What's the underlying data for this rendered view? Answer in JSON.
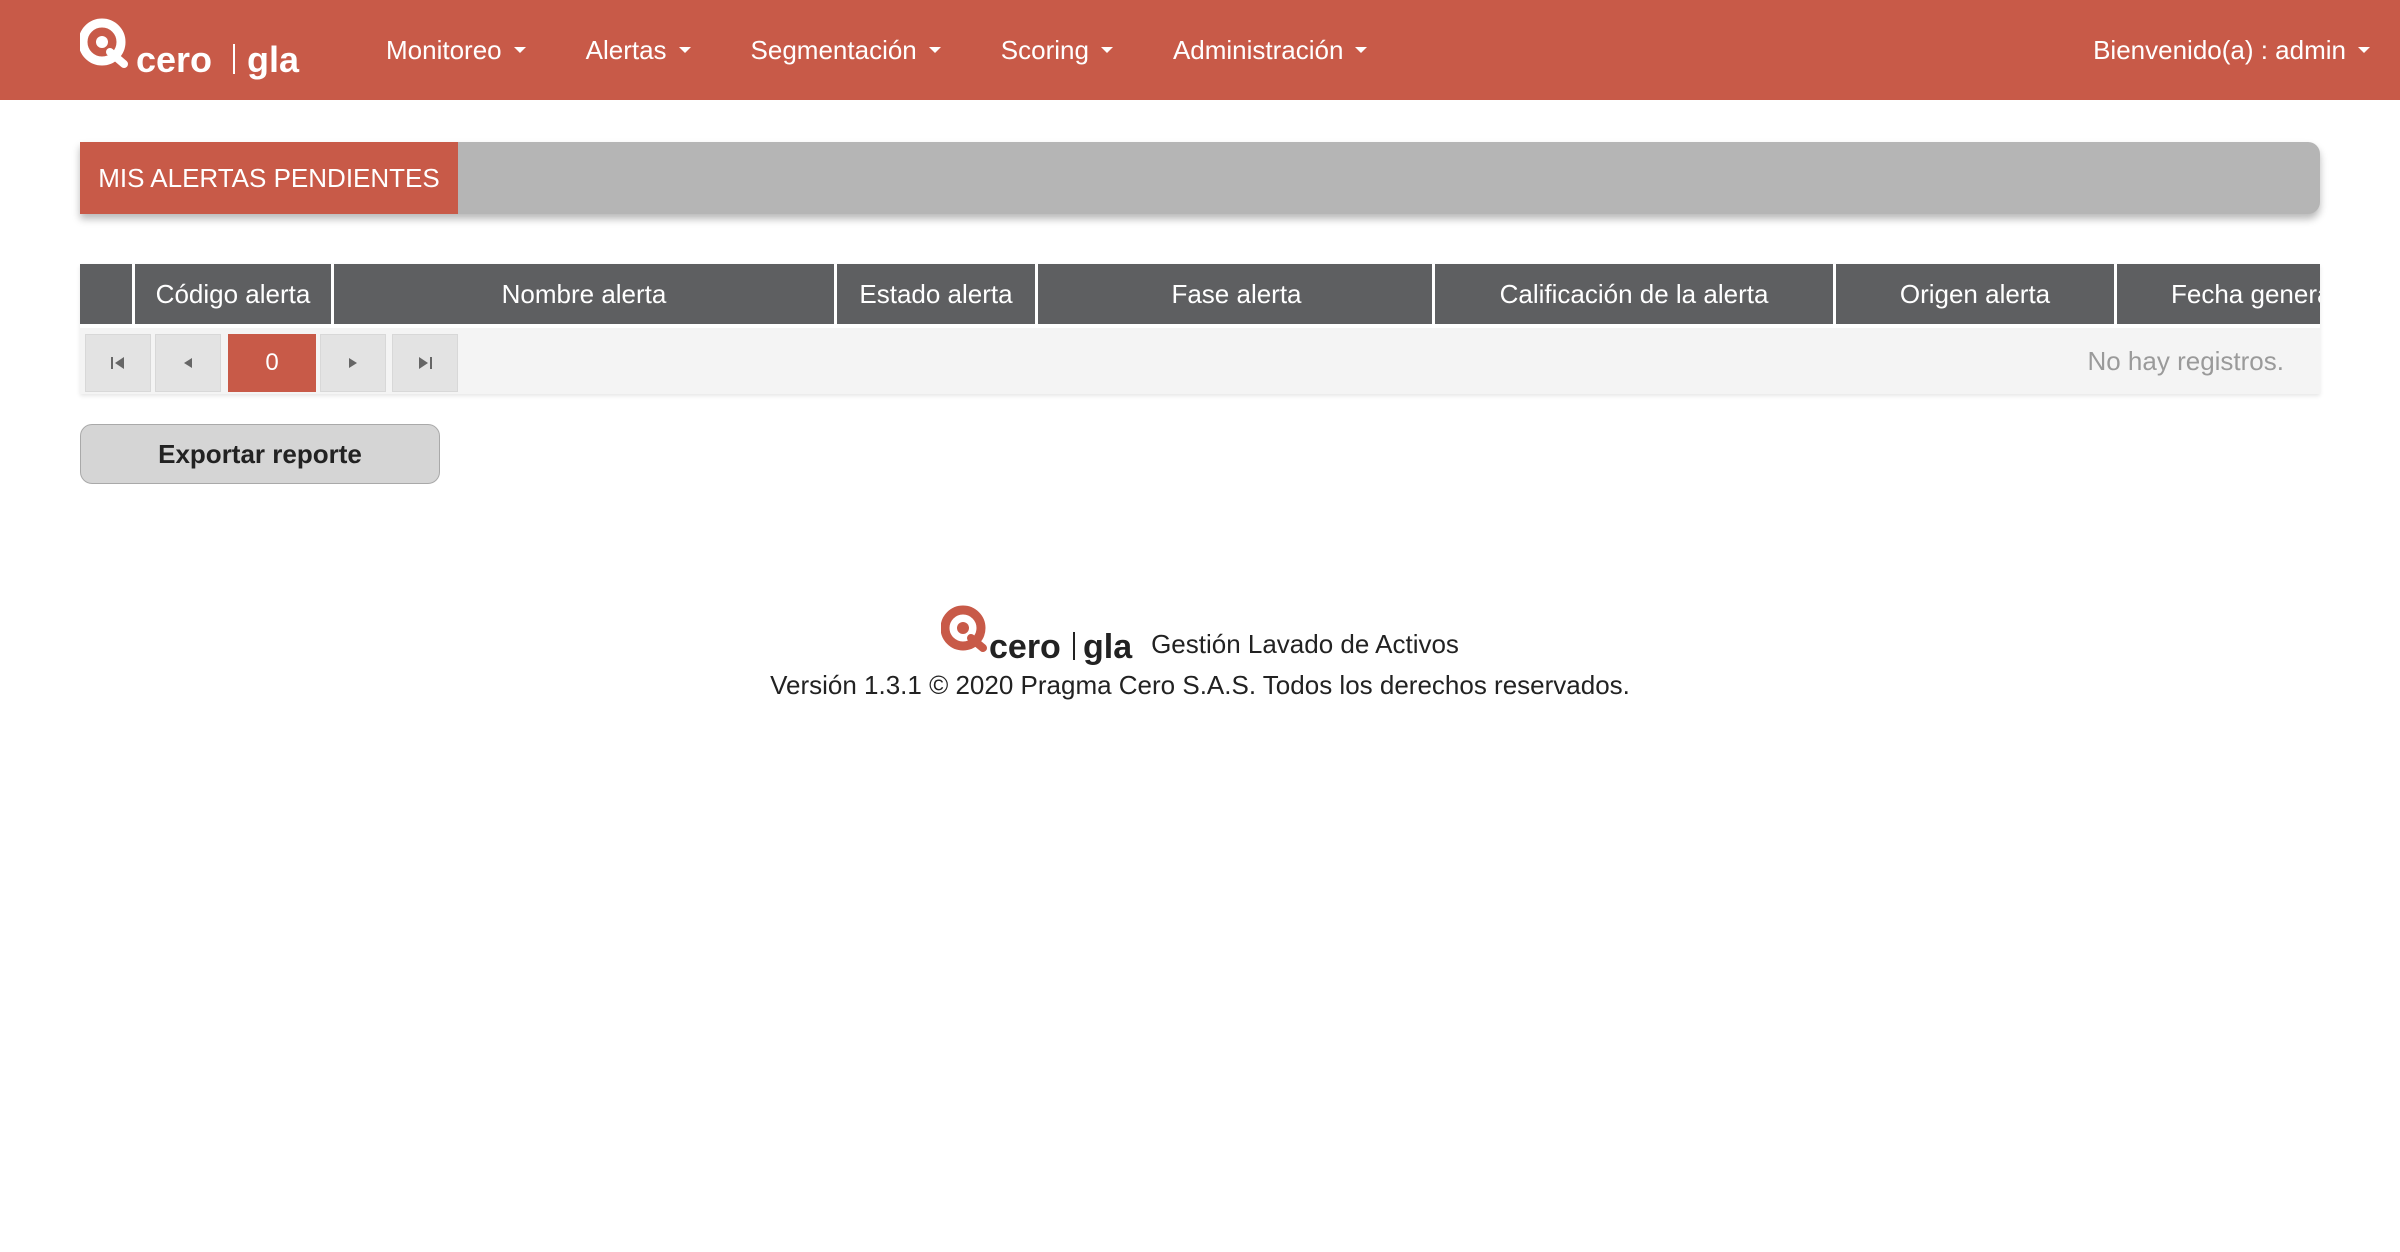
{
  "brand": {
    "logo_main": "cero",
    "logo_sub": "gla"
  },
  "nav": {
    "items": [
      {
        "label": "Monitoreo"
      },
      {
        "label": "Alertas"
      },
      {
        "label": "Segmentación"
      },
      {
        "label": "Scoring"
      },
      {
        "label": "Administración"
      }
    ],
    "user_label": "Bienvenido(a) : admin"
  },
  "section": {
    "title": "MIS ALERTAS PENDIENTES"
  },
  "table": {
    "columns": [
      "",
      "Código alerta",
      "Nombre alerta",
      "Estado alerta",
      "Fase alerta",
      "Calificación de la alerta",
      "Origen alerta",
      "Fecha genera"
    ],
    "rows": [],
    "empty_message": "No hay registros."
  },
  "paginator": {
    "current_page": "0",
    "first_icon": "first-page-icon",
    "prev_icon": "previous-page-icon",
    "next_icon": "next-page-icon",
    "last_icon": "last-page-icon"
  },
  "actions": {
    "export_label": "Exportar reporte"
  },
  "footer": {
    "tagline": "Gestión Lavado de Activos",
    "version_text": "Versión 1.3.1 © 2020 Pragma Cero S.A.S. Todos los derechos reservados."
  },
  "colors": {
    "brand_red": "#c85a48",
    "header_gray": "#b5b5b5",
    "table_header": "#5e5f61"
  }
}
